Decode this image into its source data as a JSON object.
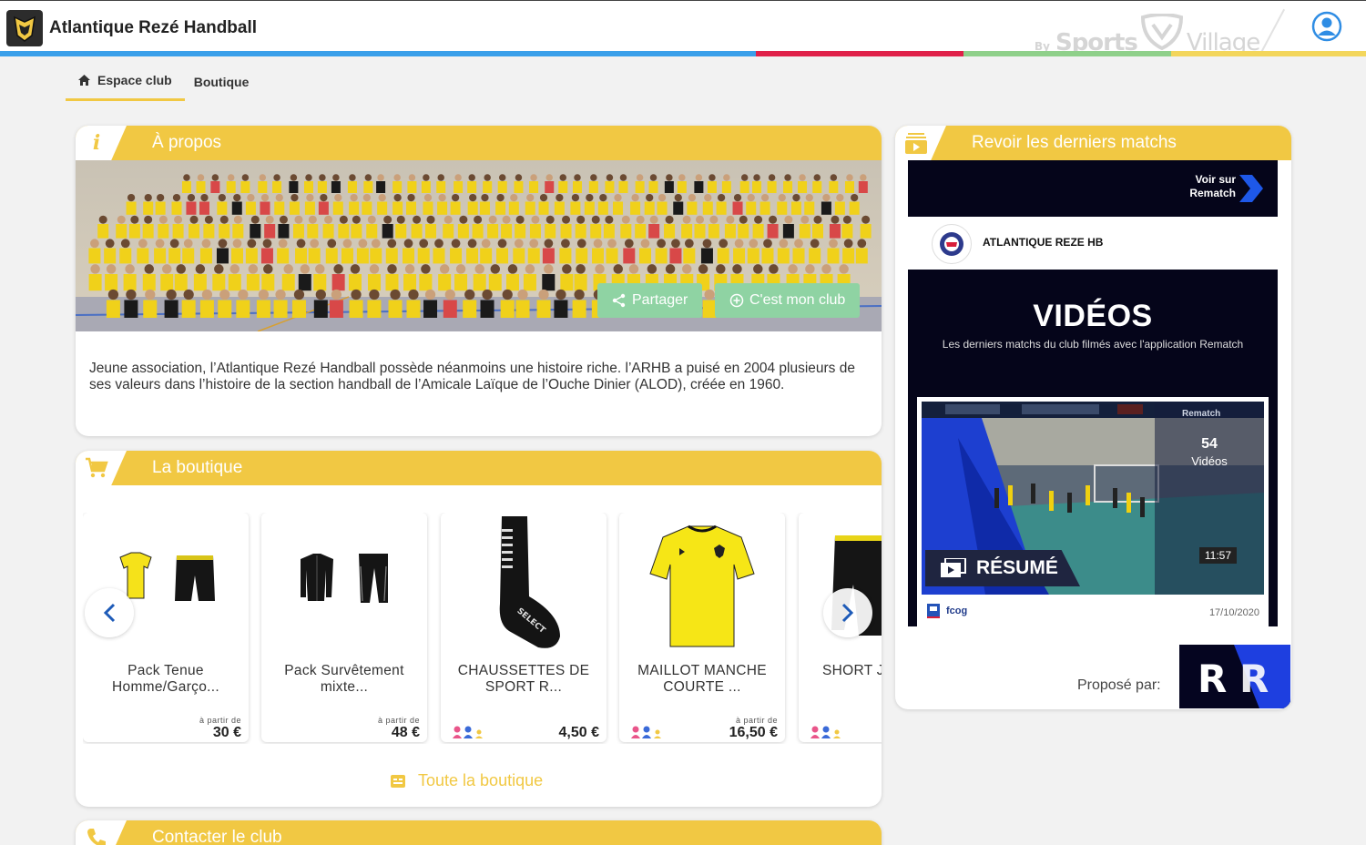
{
  "header": {
    "club_name": "Atlantique Rezé Handball",
    "brand_by": "By",
    "brand_sports": "Sports",
    "brand_village": "Village"
  },
  "breadcrumb": {
    "home": "Espace club",
    "shop": "Boutique"
  },
  "about": {
    "title": "À propos",
    "share": "Partager",
    "my_club": "C'est mon club",
    "text": "Jeune association, l’Atlantique Rezé Handball possède néanmoins une histoire riche. l’ARHB a puisé en 2004 plusieurs de ses valeurs dans l’histoire de la section handball de l’Amicale Laïque de l’Ouche Dinier (ALOD), créée en 1960."
  },
  "shop": {
    "title": "La boutique",
    "all_link": "Toute la boutique",
    "products": [
      {
        "name": "Pack Tenue Homme/Garço...",
        "from": "à partir de",
        "price": "30 €",
        "gender": false
      },
      {
        "name": "Pack Survêtement mixte...",
        "from": "à partir de",
        "price": "48 €",
        "gender": false
      },
      {
        "name": "CHAUSSETTES DE SPORT R...",
        "from": "",
        "price": "4,50 €",
        "gender": true
      },
      {
        "name": "MAILLOT MANCHE COURTE ...",
        "from": "à partir de",
        "price": "16,50 €",
        "gender": true
      },
      {
        "name": "SHORT J ARGEI",
        "from": "",
        "price": "",
        "gender": true
      }
    ]
  },
  "contact": {
    "title": "Contacter le club"
  },
  "matches": {
    "title": "Revoir les derniers matchs",
    "rematch_link": "Voir sur Rematch",
    "club_name": "ATLANTIQUE REZE HB",
    "videos_title": "VIDÉOS",
    "videos_subtitle": "Les derniers matchs du club filmés avec l'application Rematch",
    "count": "54",
    "count_label": "Vidéos",
    "duration": "11:57",
    "resume": "RÉSUMÉ",
    "author": "fcog",
    "date": "17/10/2020",
    "proposed_by": "Proposé par:",
    "thumb_brand": "Rematch"
  },
  "colors": {
    "accent_yellow": "#f1c843",
    "stripe_blue": "#3aa0ea",
    "stripe_red": "#e0214a",
    "stripe_green": "#8fd08a",
    "stripe_yellow": "#f3d65c",
    "green_button": "#8fd3a3",
    "rematch_dark": "#05051a"
  }
}
